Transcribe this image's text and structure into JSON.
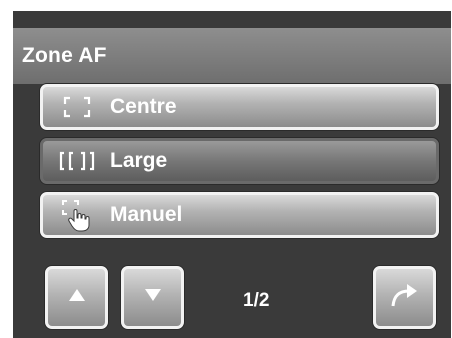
{
  "header": {
    "title": "Zone AF"
  },
  "options": [
    {
      "label": "Centre",
      "icon": "af-centre-icon",
      "selected": false
    },
    {
      "label": "Large",
      "icon": "af-wide-icon",
      "selected": true
    },
    {
      "label": "Manuel",
      "icon": "af-manual-touch-icon",
      "selected": false
    }
  ],
  "footer": {
    "up_icon": "arrow-up-icon",
    "down_icon": "arrow-down-icon",
    "page": "1/2",
    "return_icon": "return-arrow-icon"
  },
  "colors": {
    "screen_bg": "#3a3a3a",
    "title_bg": "#7e7e7e",
    "button_border": "#f2f2f2",
    "text": "#ffffff"
  }
}
